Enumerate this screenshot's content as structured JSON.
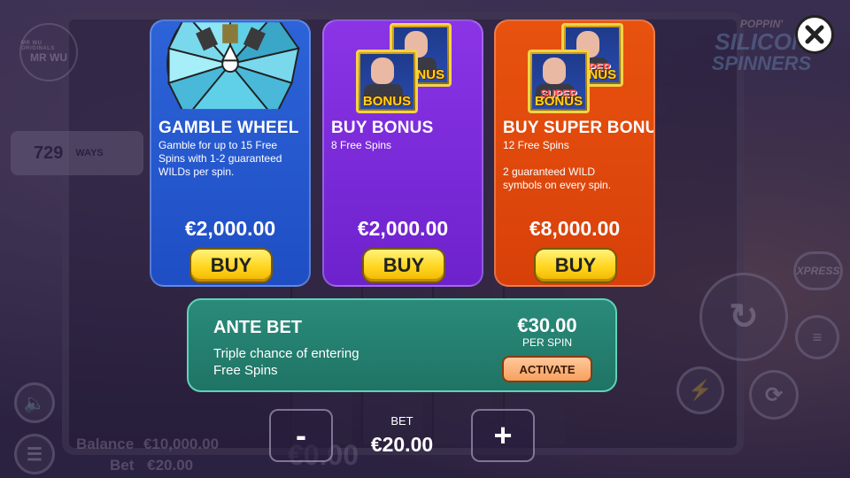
{
  "background": {
    "provider_logo": "MR WU",
    "provider_logo_sub": "MR WU ORIGINALS",
    "ways_count": "729",
    "ways_label": "WAYS",
    "game_logo_line1": "POPPIN'",
    "game_logo_line2": "SILICON",
    "game_logo_line3": "SPINNERS",
    "balance_label": "Balance",
    "balance_value": "€10,000.00",
    "bet_label": "Bet",
    "bet_value": "€20.00",
    "win_value": "€0.00",
    "xpress_label": "XPRESS"
  },
  "cards": [
    {
      "title": "GAMBLE WHEEL",
      "description": "Gamble for up to 15 Free\nSpins with 1-2 guaranteed\nWILDs per spin.",
      "price": "€2,000.00",
      "button": "BUY",
      "color": "#2d63d8"
    },
    {
      "title": "BUY BONUS",
      "description": "8 Free Spins",
      "price": "€2,000.00",
      "button": "BUY",
      "badge_label": "BONUS",
      "color": "#8a34e6"
    },
    {
      "title": "BUY SUPER BONUS",
      "description": "12 Free Spins\n\n2 guaranteed WILD\nsymbols on every spin.",
      "price": "€8,000.00",
      "button": "BUY",
      "badge_label": "BONUS",
      "badge_super": "SUPER",
      "color": "#e8520e"
    }
  ],
  "ante": {
    "title": "ANTE BET",
    "description": "Triple chance of entering\nFree Spins",
    "price": "€30.00",
    "per_spin": "PER SPIN",
    "button": "ACTIVATE"
  },
  "bet_control": {
    "label": "BET",
    "value": "€20.00",
    "minus": "-",
    "plus": "+"
  }
}
